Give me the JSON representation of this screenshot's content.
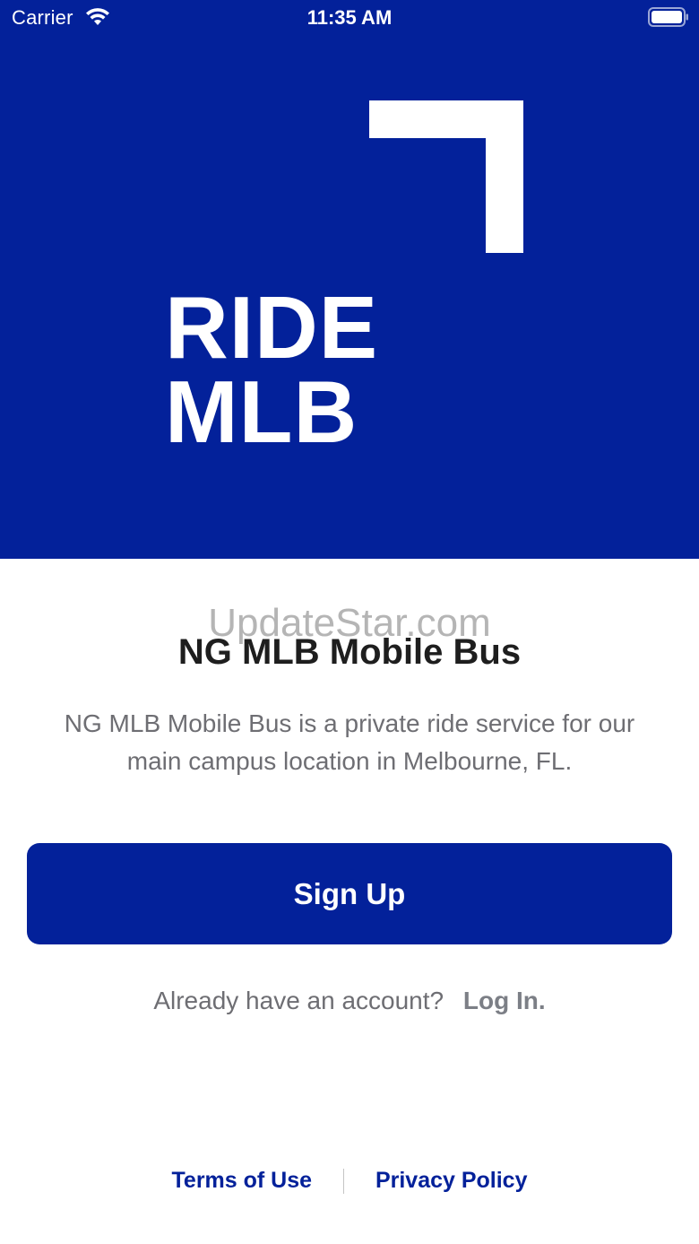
{
  "status_bar": {
    "carrier": "Carrier",
    "time": "11:35 AM"
  },
  "hero": {
    "logo_line1": "RIDE",
    "logo_line2": "MLB",
    "background": "#03219a"
  },
  "watermark": "UpdateStar.com",
  "title": "NG MLB Mobile Bus",
  "description": "NG MLB Mobile Bus is a private ride service for our main campus location in Melbourne, FL.",
  "signup_button": "Sign Up",
  "login": {
    "prompt": "Already have an account?",
    "link": "Log In."
  },
  "footer": {
    "terms": "Terms of Use",
    "privacy": "Privacy Policy"
  },
  "colors": {
    "brand": "#03219a",
    "text_dark": "#1e1e1e",
    "text_muted": "#6e6e73"
  }
}
